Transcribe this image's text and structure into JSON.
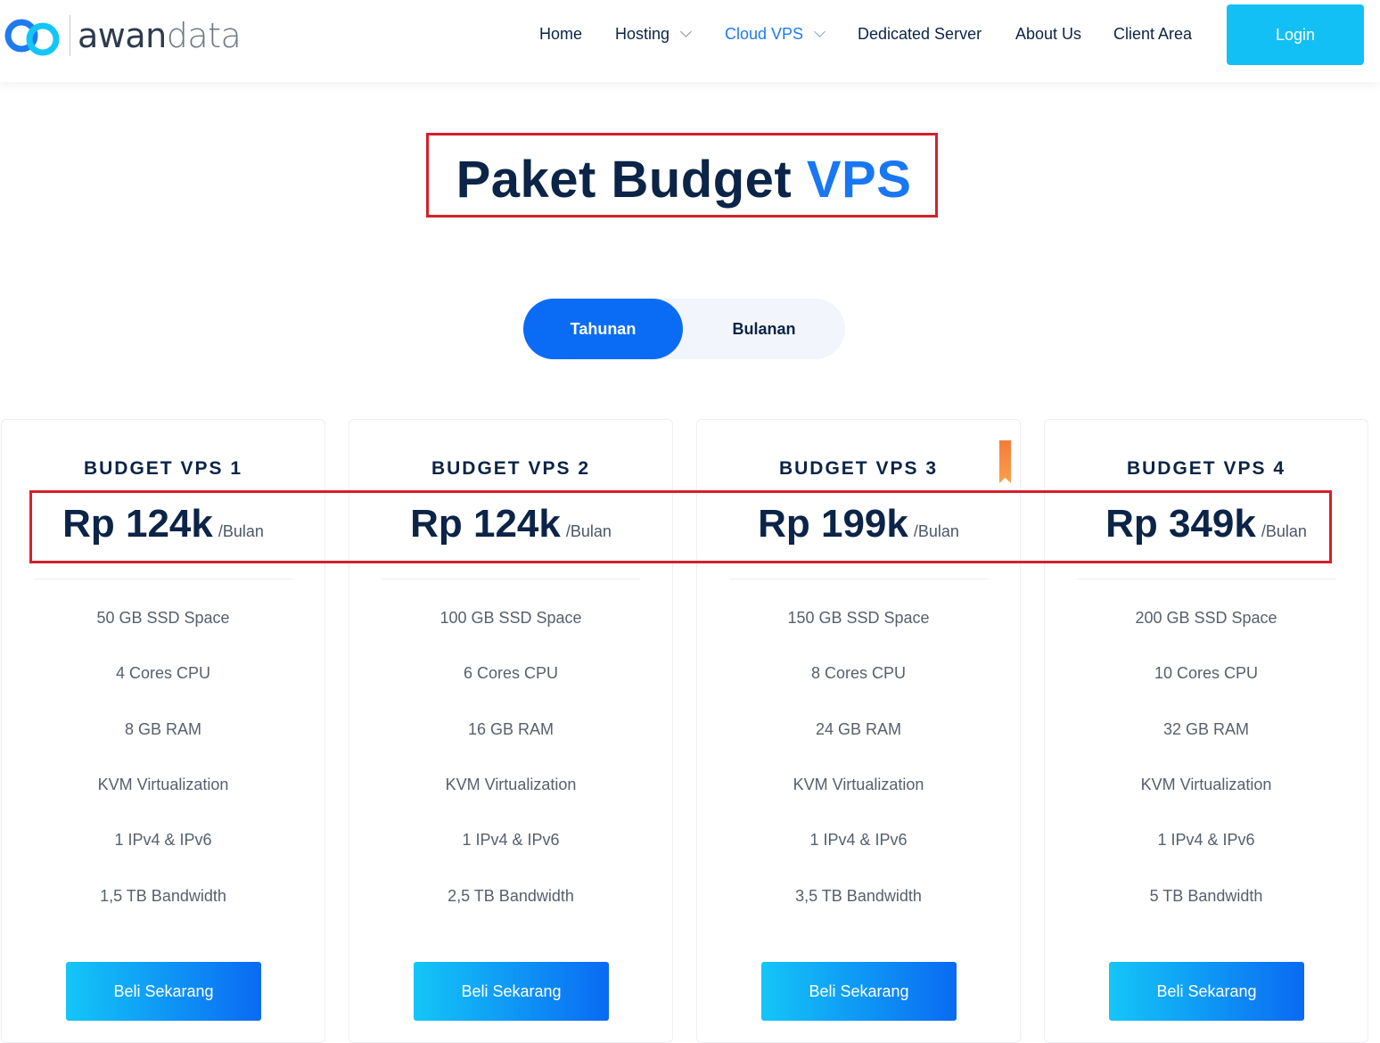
{
  "brand": {
    "logo_part1": "awan",
    "logo_part2": "data"
  },
  "nav": {
    "home": "Home",
    "hosting": "Hosting",
    "cloud_vps": "Cloud VPS",
    "dedicated": "Dedicated Server",
    "about": "About Us",
    "client_area": "Client Area",
    "login": "Login"
  },
  "title": {
    "main": "Paket Budget",
    "highlight": "VPS"
  },
  "billing": {
    "yearly": "Tahunan",
    "monthly": "Bulanan",
    "selected": "Tahunan"
  },
  "plans": [
    {
      "name": "BUDGET VPS 1",
      "price": "Rp 124k",
      "period": "/Bulan",
      "features": [
        "50 GB SSD Space",
        "4 Cores CPU",
        "8 GB RAM",
        "KVM Virtualization",
        "1 IPv4 & IPv6",
        "1,5 TB Bandwidth"
      ],
      "cta": "Beli Sekarang"
    },
    {
      "name": "BUDGET VPS 2",
      "price": "Rp 124k",
      "period": "/Bulan",
      "features": [
        "100 GB SSD Space",
        "6 Cores CPU",
        "16 GB RAM",
        "KVM Virtualization",
        "1 IPv4 & IPv6",
        "2,5 TB Bandwidth"
      ],
      "cta": "Beli Sekarang"
    },
    {
      "name": "BUDGET VPS 3",
      "price": "Rp 199k",
      "period": "/Bulan",
      "features": [
        "150 GB SSD Space",
        "8 Cores CPU",
        "24 GB RAM",
        "KVM Virtualization",
        "1 IPv4 & IPv6",
        "3,5 TB Bandwidth"
      ],
      "cta": "Beli Sekarang"
    },
    {
      "name": "BUDGET VPS 4",
      "price": "Rp 349k",
      "period": "/Bulan",
      "features": [
        "200 GB SSD Space",
        "10 Cores CPU",
        "32 GB RAM",
        "KVM Virtualization",
        "1 IPv4 & IPv6",
        "5 TB Bandwidth"
      ],
      "cta": "Beli Sekarang"
    }
  ],
  "colors": {
    "primary": "#0a6cf5",
    "accent": "#12c0f5",
    "heading": "#0b2447",
    "highlight_box": "#d4202b",
    "ribbon": "#f47b3a"
  },
  "icons": {
    "logo": "cloud-logo-icon",
    "dropdown": "chevron-down-icon",
    "ribbon": "bookmark-ribbon-icon"
  }
}
